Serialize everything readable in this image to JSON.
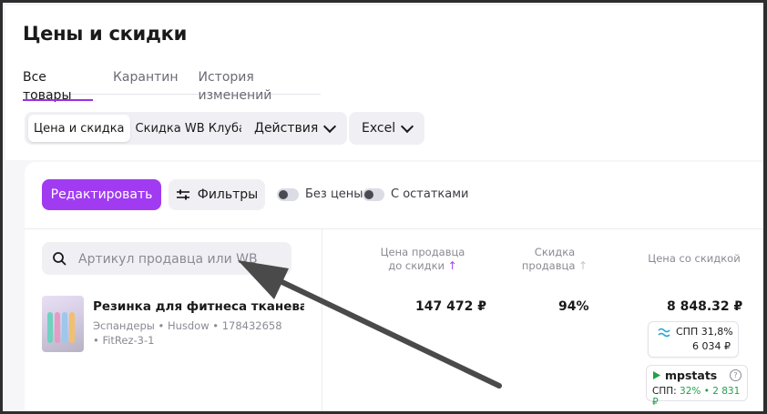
{
  "page": {
    "title": "Цены и скидки"
  },
  "tabs": [
    {
      "label": "Все товары",
      "active": true
    },
    {
      "label": "Карантин",
      "active": false
    },
    {
      "label": "История изменений",
      "active": false
    }
  ],
  "segment": {
    "options": [
      "Цена и скидка",
      "Скидка WB Клуба"
    ],
    "selected": "Цена и скидка"
  },
  "dropdowns": {
    "actions": "Действия",
    "excel": "Excel"
  },
  "toolbar": {
    "edit_label": "Редактировать",
    "filters_label": "Фильтры",
    "toggle_no_price": "Без цены",
    "toggle_with_stock": "С остатками"
  },
  "search": {
    "placeholder": "Артикул продавца или WB",
    "value": ""
  },
  "columns": {
    "seller_price": [
      "Цена продавца",
      "до скидки"
    ],
    "seller_discount": [
      "Скидка",
      "продавца"
    ],
    "discounted_price": "Цена со скидкой"
  },
  "product": {
    "name": "Резинка для фитнеса тканевая (+...",
    "meta_line1": "Эспандеры • Husdow • 178432658",
    "meta_line2": "• FitRez-3-1",
    "price_before": "147 472 ₽",
    "discount": "94%",
    "price_after": "8 848.32 ₽",
    "spp": {
      "label": "СПП 31,8%",
      "value": "6 034 ₽"
    },
    "mpstats": {
      "brand": "mpstats",
      "line": "СПП:",
      "pct": "32%",
      "rest": "• 2 831 ₽"
    }
  },
  "colors": {
    "accent": "#a13bf2",
    "mpstats_green": "#22a04b"
  },
  "icons": [
    "search-icon",
    "filter-icon",
    "chevron-down-icon",
    "sort-arrow-icon",
    "help-icon",
    "mpstats-logo-icon",
    "spp-logo-icon"
  ]
}
